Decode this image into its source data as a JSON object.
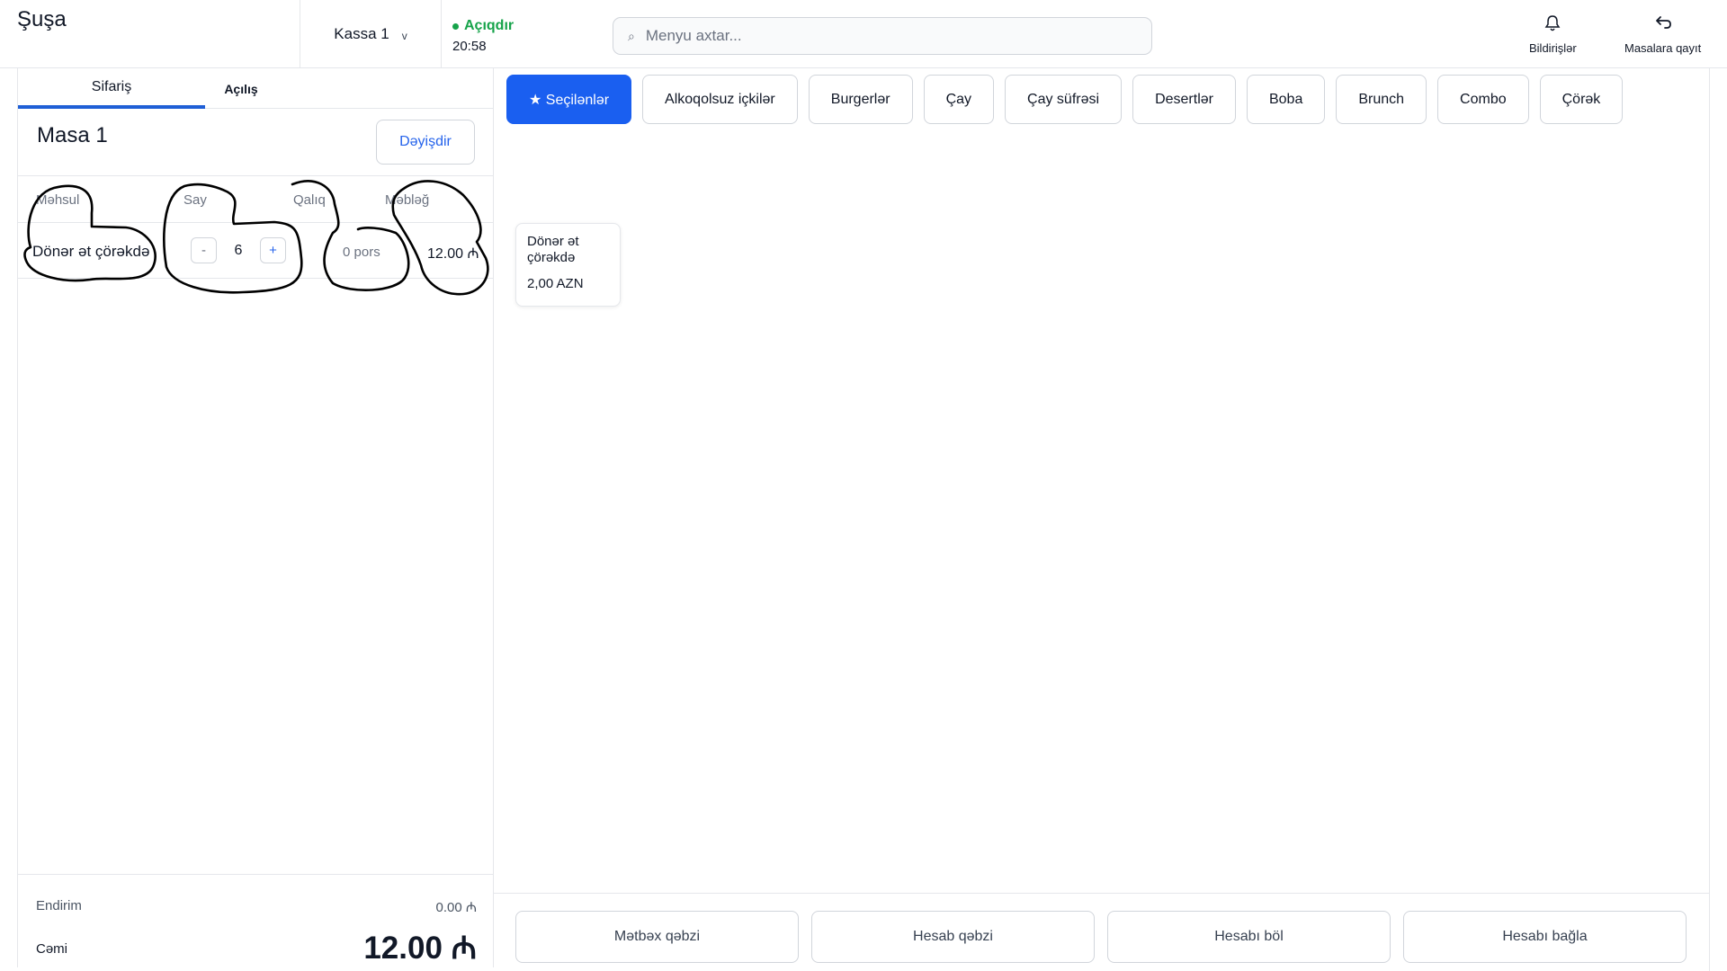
{
  "header": {
    "brand": "Şuşa",
    "kassa_label": "Kassa 1",
    "kassa_chevron": "v",
    "status_text": "Açıqdır",
    "status_color": "#16a34a",
    "time": "20:58",
    "search_placeholder": "Menyu axtar...",
    "search_icon": "search-icon",
    "notifications_label": "Bildirişlər",
    "notifications_icon": "bell-icon",
    "back_label": "Masalara qayıt",
    "back_icon": "return-arrow-icon"
  },
  "order_panel": {
    "tabs": [
      {
        "label": "Sifariş",
        "active": true
      },
      {
        "label": "Açılış",
        "active": false
      }
    ],
    "table_name": "Masa 1",
    "change_button": "Dəyişdir",
    "columns": [
      "Məhsul",
      "Say",
      "Qalıq",
      "Məbləğ"
    ],
    "items": [
      {
        "name": "Dönər ət çörəkdə",
        "qty": "6",
        "minus": "-",
        "plus": "+",
        "remaining": "0 pors",
        "amount": "12.00 ₼"
      }
    ],
    "discount_label": "Endirim",
    "discount_value": "0.00 ₼",
    "total_label": "Cəmi",
    "total_value": "12.00 ₼"
  },
  "menu": {
    "accent_color": "#1a5ff0",
    "categories": [
      {
        "label": "★ Seçilənlər",
        "active": true
      },
      {
        "label": "Alkoqolsuz içkilər",
        "active": false
      },
      {
        "label": "Burgerlər",
        "active": false
      },
      {
        "label": "Çay",
        "active": false
      },
      {
        "label": "Çay süfrəsi",
        "active": false
      },
      {
        "label": "Desertlər",
        "active": false
      },
      {
        "label": "Boba",
        "active": false
      },
      {
        "label": "Brunch",
        "active": false
      },
      {
        "label": "Combo",
        "active": false
      },
      {
        "label": "Çörək",
        "active": false
      }
    ],
    "products": [
      {
        "name": "Dönər ət çörəkdə",
        "price": "2,00 AZN"
      }
    ]
  },
  "actions": {
    "kitchen_receipt": "Mətbəx qəbzi",
    "bill_receipt": "Hesab qəbzi",
    "split_bill": "Hesabı böl",
    "close_bill": "Hesabı bağla"
  }
}
